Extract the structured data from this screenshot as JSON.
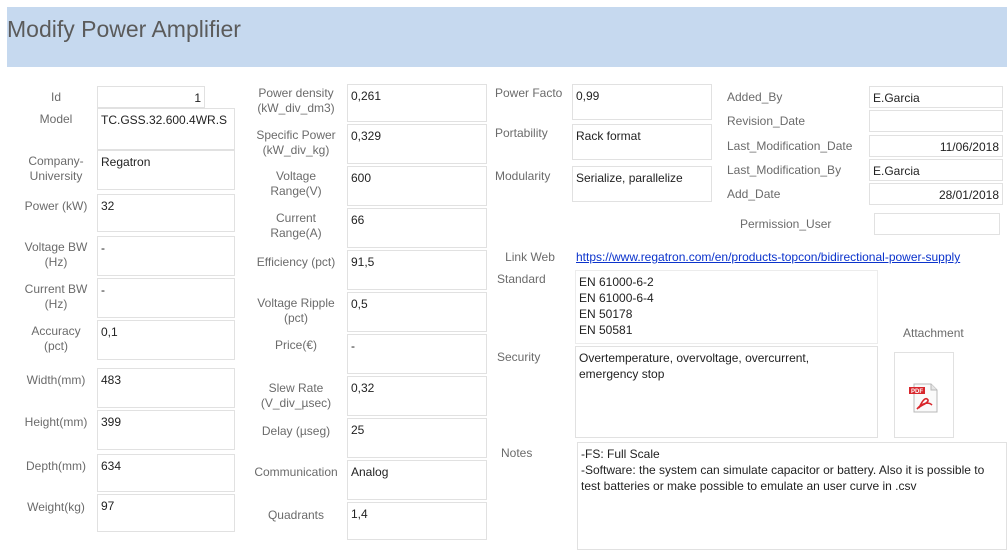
{
  "header": {
    "title": "Modify Power Amplifier"
  },
  "col1": [
    {
      "label": "Id",
      "value": "1"
    },
    {
      "label": "Model",
      "value": "TC.GSS.32.600.4WR.S"
    },
    {
      "label": "Company-\nUniversity",
      "value": "Regatron"
    },
    {
      "label": "Power (kW)",
      "value": "32"
    },
    {
      "label": "Voltage BW\n(Hz)",
      "value": "-"
    },
    {
      "label": "Current BW\n(Hz)",
      "value": "-"
    },
    {
      "label": "Accuracy\n(pct)",
      "value": "0,1"
    },
    {
      "label": "Width(mm)",
      "value": "483"
    },
    {
      "label": "Height(mm)",
      "value": "399"
    },
    {
      "label": "Depth(mm)",
      "value": "634"
    },
    {
      "label": "Weight(kg)",
      "value": "97"
    }
  ],
  "col2": [
    {
      "label": "Power density\n(kW_div_dm3)",
      "value": "0,261"
    },
    {
      "label": "Specific Power\n(kW_div_kg)",
      "value": "0,329"
    },
    {
      "label": "Voltage\nRange(V)",
      "value": "600"
    },
    {
      "label": "Current\nRange(A)",
      "value": "66"
    },
    {
      "label": "Efficiency (pct)",
      "value": "91,5"
    },
    {
      "label": "Voltage Ripple\n(pct)",
      "value": "0,5"
    },
    {
      "label": "Price(€)",
      "value": "-"
    },
    {
      "label": "Slew Rate\n(V_div_µsec)",
      "value": "0,32"
    },
    {
      "label": "Delay (µseg)",
      "value": "25"
    },
    {
      "label": "Communication",
      "value": "Analog"
    },
    {
      "label": "Quadrants",
      "value": "1,4"
    }
  ],
  "col3": [
    {
      "label": "Power Facto",
      "value": "0,99"
    },
    {
      "label": "Portability",
      "value": "Rack format"
    },
    {
      "label": "Modularity",
      "value": "Serialize, parallelize"
    }
  ],
  "col4": [
    {
      "label": "Added_By",
      "value": "E.Garcia"
    },
    {
      "label": "Revision_Date",
      "value": ""
    },
    {
      "label": "Last_Modification_Date",
      "value": "11/06/2018"
    },
    {
      "label": "Last_Modification_By",
      "value": "E.Garcia"
    },
    {
      "label": "Add_Date",
      "value": "28/01/2018"
    },
    {
      "label": "Permission_User",
      "value": ""
    }
  ],
  "link_web": {
    "label": "Link Web",
    "value": "https://www.regatron.com/en/products-topcon/bidirectional-power-supply"
  },
  "standard": {
    "label": "Standard",
    "value": "EN 61000-6-2\nEN 61000-6-4\nEN 50178\nEN 50581"
  },
  "security": {
    "label": "Security",
    "value": "Overtemperature, overvoltage, overcurrent,\nemergency stop"
  },
  "notes": {
    "label": "Notes",
    "value": "-FS: Full Scale\n-Software: the system can simulate capacitor or battery. Also it is possible to\ntest batteries or make possible to emulate an user curve in .csv"
  },
  "attachment": {
    "label": "Attachment",
    "icon": "pdf-file-icon"
  }
}
